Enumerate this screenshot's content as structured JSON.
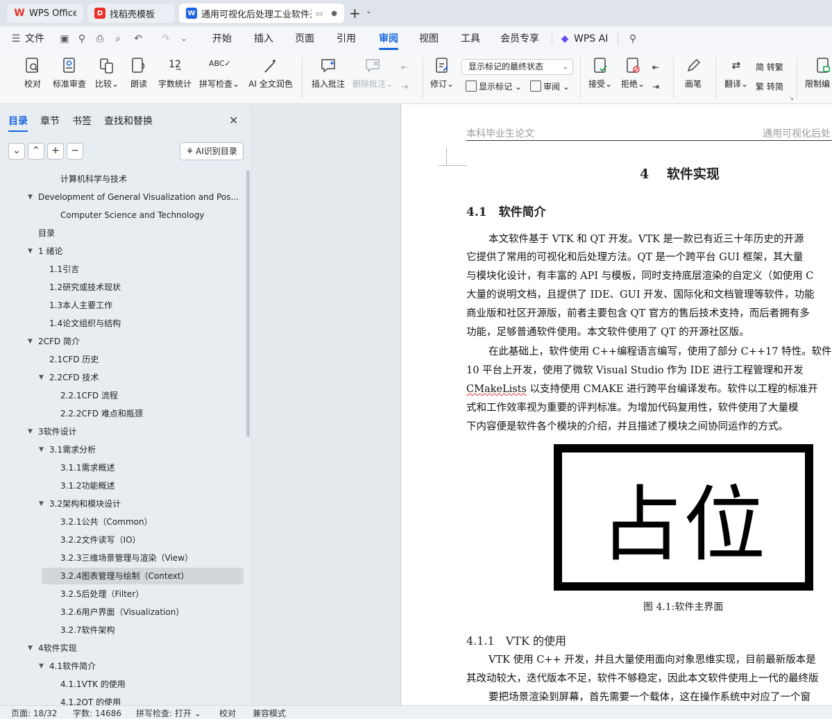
{
  "tabs": [
    {
      "title": "WPS Office",
      "logo": "W",
      "logo_color": "#e8312b"
    },
    {
      "title": "找稻壳模板",
      "logo": "D",
      "logo_color": "#e8312b"
    },
    {
      "title": "通用可视化后处理工业软件开",
      "logo": "W",
      "logo_color": "#1d62e5"
    }
  ],
  "new_tab_symbol": "+",
  "menubar": {
    "file": "文件",
    "items": [
      "开始",
      "插入",
      "页面",
      "引用",
      "审阅",
      "视图",
      "工具",
      "会员专享"
    ],
    "active": "审阅",
    "wps_ai": "WPS AI"
  },
  "ribbon": {
    "buttons": [
      {
        "label": "校对"
      },
      {
        "label": "标准审查"
      },
      {
        "label": "比较"
      },
      {
        "label": "朗读"
      },
      {
        "label": "字数统计"
      },
      {
        "label": "拼写检查"
      },
      {
        "label": "AI 全文润色"
      },
      {
        "label": "插入批注"
      },
      {
        "label": "删除批注"
      }
    ],
    "track_changes": "修订",
    "markup_combo": "显示标记的最终状态",
    "show_markup": "显示标记",
    "review_pane": "审阅",
    "accept": "接受",
    "reject": "拒绝",
    "draw": "画笔",
    "translate": "翻译",
    "to_traditional": "简 转繁",
    "to_simplified": "繁 转简",
    "restrict": "限制编"
  },
  "panel": {
    "tabs": [
      "目录",
      "章节",
      "书签",
      "查找和替换"
    ],
    "active_tab": "目录",
    "ai_toc": "AI识别目录",
    "toc": [
      {
        "text": "计算机科学与技术",
        "level": 3,
        "caret": ""
      },
      {
        "text": "Development of General Visualization and Post- ...",
        "level": 1,
        "caret": "▼"
      },
      {
        "text": "Computer Science and Technology",
        "level": 3,
        "caret": ""
      },
      {
        "text": "目录",
        "level": 1,
        "caret": ""
      },
      {
        "text": "1 绪论",
        "level": 1,
        "caret": "▼"
      },
      {
        "text": "1.1引言",
        "level": 2,
        "caret": ""
      },
      {
        "text": "1.2研究或技术现状",
        "level": 2,
        "caret": ""
      },
      {
        "text": "1.3本人主要工作",
        "level": 2,
        "caret": ""
      },
      {
        "text": "1.4论文组织与结构",
        "level": 2,
        "caret": ""
      },
      {
        "text": "2CFD 简介",
        "level": 1,
        "caret": "▼"
      },
      {
        "text": "2.1CFD 历史",
        "level": 2,
        "caret": ""
      },
      {
        "text": "2.2CFD 技术",
        "level": 2,
        "caret": "▼"
      },
      {
        "text": "2.2.1CFD 流程",
        "level": 3,
        "caret": ""
      },
      {
        "text": "2.2.2CFD 难点和瓶颈",
        "level": 3,
        "caret": ""
      },
      {
        "text": "3软件设计",
        "level": 1,
        "caret": "▼"
      },
      {
        "text": "3.1需求分析",
        "level": 2,
        "caret": "▼"
      },
      {
        "text": "3.1.1需求概述",
        "level": 3,
        "caret": ""
      },
      {
        "text": "3.1.2功能概述",
        "level": 3,
        "caret": ""
      },
      {
        "text": "3.2架构和模块设计",
        "level": 2,
        "caret": "▼"
      },
      {
        "text": "3.2.1公共（Common）",
        "level": 3,
        "caret": ""
      },
      {
        "text": "3.2.2文件读写（IO）",
        "level": 3,
        "caret": ""
      },
      {
        "text": "3.2.3三维场景管理与渲染（View）",
        "level": 3,
        "caret": ""
      },
      {
        "text": "3.2.4图表管理与绘制（Context）",
        "level": 3,
        "caret": "",
        "selected": true
      },
      {
        "text": "3.2.5后处理（Filter）",
        "level": 3,
        "caret": ""
      },
      {
        "text": "3.2.6用户界面（Visualization）",
        "level": 3,
        "caret": ""
      },
      {
        "text": "3.2.7软件架构",
        "level": 3,
        "caret": ""
      },
      {
        "text": "4软件实现",
        "level": 1,
        "caret": "▼"
      },
      {
        "text": "4.1软件简介",
        "level": 2,
        "caret": "▼"
      },
      {
        "text": "4.1.1VTK 的使用",
        "level": 3,
        "caret": ""
      },
      {
        "text": "4.1.2QT 的使用",
        "level": 3,
        "caret": ""
      }
    ]
  },
  "doc": {
    "header_left": "本科毕业生论文",
    "header_right": "通用可视化后处",
    "chapter": "4　 软件实现",
    "section": "4.1　软件简介",
    "para1": [
      "本文软件基于  VTK 和 QT 开发。VTK 是一款已有近三十年历史的开源",
      "它提供了常用的可视化和后处理方法。QT 是一个跨平台  GUI 框架，其大量",
      "与模块化设计，有丰富的  API 与模板，同时支持底层渲染的自定义（如使用  C",
      "大量的说明文档，且提供了  IDE、GUI 开发、国际化和文档管理等软件，功能",
      "商业版和社区开源版，前者主要包含  QT 官方的售后技术支持，而后者拥有多",
      "功能，足够普通软件使用。本文软件使用了  QT 的开源社区版。"
    ],
    "para2": [
      "在此基础上，软件使用  C++编程语言编写，使用了部分  C++17 特性。软件",
      "10 平台上开发，使用了微软  Visual Studio 作为  IDE 进行工程管理和开发",
      "以支持使用  CMAKE 进行跨平台编译发布。软件以工程的标准开",
      "式和工作效率视为重要的评判标准。为增加代码复用性，软件使用了大量模",
      "下内容便是软件各个模块的介绍，并且描述了模块之间协同运作的方式。"
    ],
    "cmakelists": "CMakeLists",
    "placeholder": "占位",
    "figure_caption": "图  4.1:软件主界面",
    "subsection": "4.1.1　VTK 的使用",
    "para3": [
      "VTK 使用  C++ 开发，并且大量使用面向对象思维实现，目前最新版本是",
      "其改动较大，迭代版本不足，软件不够稳定，因此本文软件使用上一代的最终版",
      "要把场景渲染到屏幕，首先需要一个载体，这在操作系统中对应了一个窗"
    ]
  },
  "status": {
    "page": "页面: 18/32",
    "words": "字数: 14686",
    "spell": "拼写检查: 打开",
    "proof": "校对",
    "compat": "兼容模式"
  }
}
